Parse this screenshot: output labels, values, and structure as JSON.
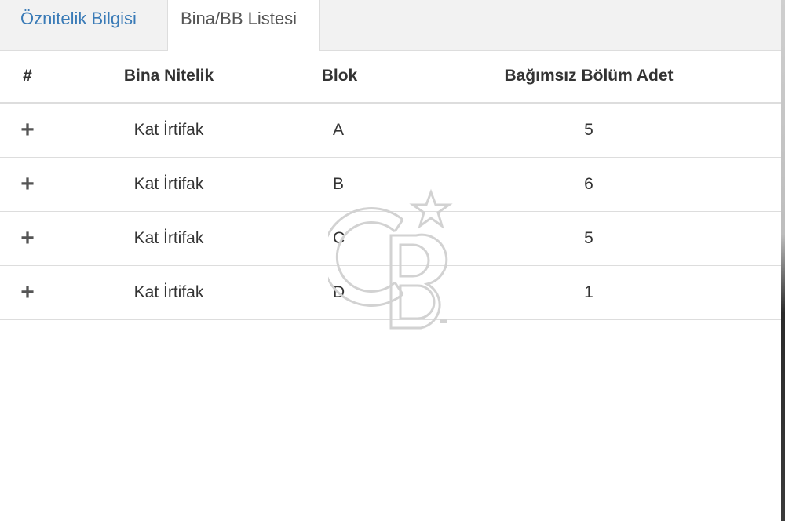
{
  "tabs": [
    {
      "label": "Öznitelik Bilgisi",
      "active": false
    },
    {
      "label": "Bina/BB Listesi",
      "active": true
    }
  ],
  "table": {
    "headers": {
      "hash": "#",
      "bina_nitelik": "Bina Nitelik",
      "blok": "Blok",
      "bagimsiz_bolum_adet": "Bağımsız Bölüm Adet"
    },
    "rows": [
      {
        "expand": "+",
        "bina_nitelik": "Kat İrtifak",
        "blok": "A",
        "adet": "5"
      },
      {
        "expand": "+",
        "bina_nitelik": "Kat İrtifak",
        "blok": "B",
        "adet": "6"
      },
      {
        "expand": "+",
        "bina_nitelik": "Kat İrtifak",
        "blok": "C",
        "adet": "5"
      },
      {
        "expand": "+",
        "bina_nitelik": "Kat İrtifak",
        "blok": "D",
        "adet": "1"
      }
    ]
  },
  "watermark": {
    "label": "CB"
  },
  "colors": {
    "link": "#3a7bb7",
    "text": "#333333",
    "border": "#dddddd",
    "tabbar_bg": "#f2f2f2"
  }
}
